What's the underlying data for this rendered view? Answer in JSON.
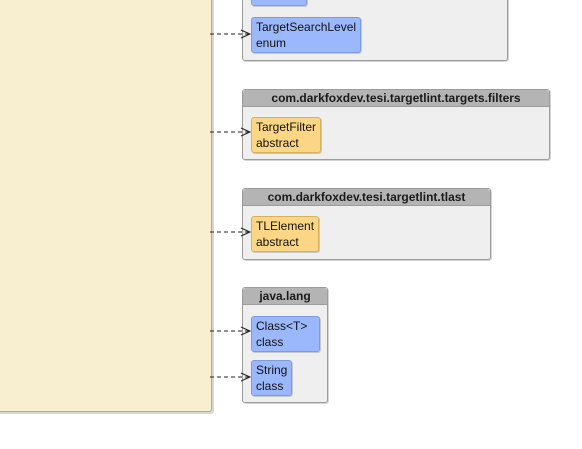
{
  "packages": [
    {
      "id": "pkg-top",
      "title": "",
      "classes": [
        {
          "name": "",
          "kind": "class",
          "color": "#9cb8fc"
        },
        {
          "name": "TargetSearchLevel",
          "kind": "enum",
          "color": "#9cb8fc"
        }
      ]
    },
    {
      "id": "pkg-filters",
      "title": "com.darkfoxdev.tesi.targetlint.targets.filters",
      "classes": [
        {
          "name": "TargetFilter",
          "kind": "abstract",
          "color": "#fbd685"
        }
      ]
    },
    {
      "id": "pkg-tlast",
      "title": "com.darkfoxdev.tesi.targetlint.tlast",
      "classes": [
        {
          "name": "TLElement",
          "kind": "abstract",
          "color": "#fbd685"
        }
      ]
    },
    {
      "id": "pkg-javalang",
      "title": "java.lang",
      "classes": [
        {
          "name": "Class<T>",
          "kind": "class",
          "color": "#9cb8fc"
        },
        {
          "name": "String",
          "kind": "class",
          "color": "#9cb8fc"
        }
      ]
    }
  ]
}
